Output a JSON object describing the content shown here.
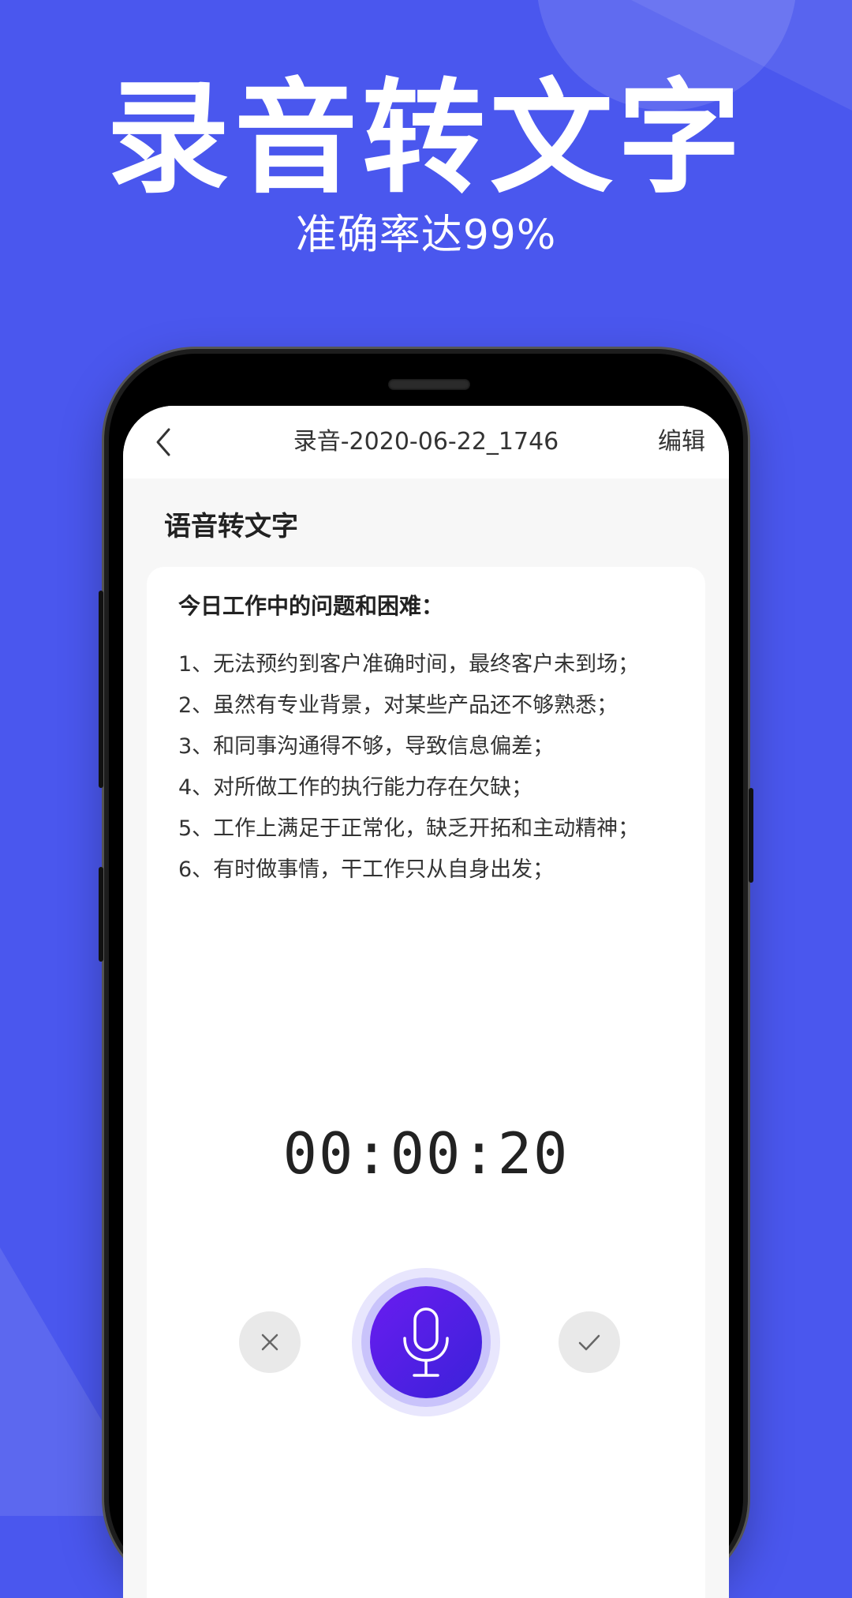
{
  "hero": {
    "title": "录音转文字",
    "subtitle": "准确率达99%"
  },
  "appbar": {
    "back_icon": "chevron-left-icon",
    "title": "录音-2020-06-22_1746",
    "edit_label": "编辑"
  },
  "section_title": "语音转文字",
  "transcript": {
    "heading": "今日工作中的问题和困难：",
    "items": [
      "1、无法预约到客户准确时间，最终客户未到场；",
      "2、虽然有专业背景，对某些产品还不够熟悉；",
      "3、和同事沟通得不够，导致信息偏差；",
      "4、对所做工作的执行能力存在欠缺；",
      "5、工作上满足于正常化，缺乏开拓和主动精神；",
      "6、有时做事情，干工作只从自身出发；"
    ]
  },
  "recorder": {
    "elapsed": "00:00:20",
    "cancel_icon": "close-icon",
    "mic_icon": "microphone-icon",
    "confirm_icon": "checkmark-icon"
  },
  "colors": {
    "background": "#4a57ee",
    "mic_gradient_start": "#6a1cf0",
    "mic_gradient_end": "#3a22d9"
  }
}
